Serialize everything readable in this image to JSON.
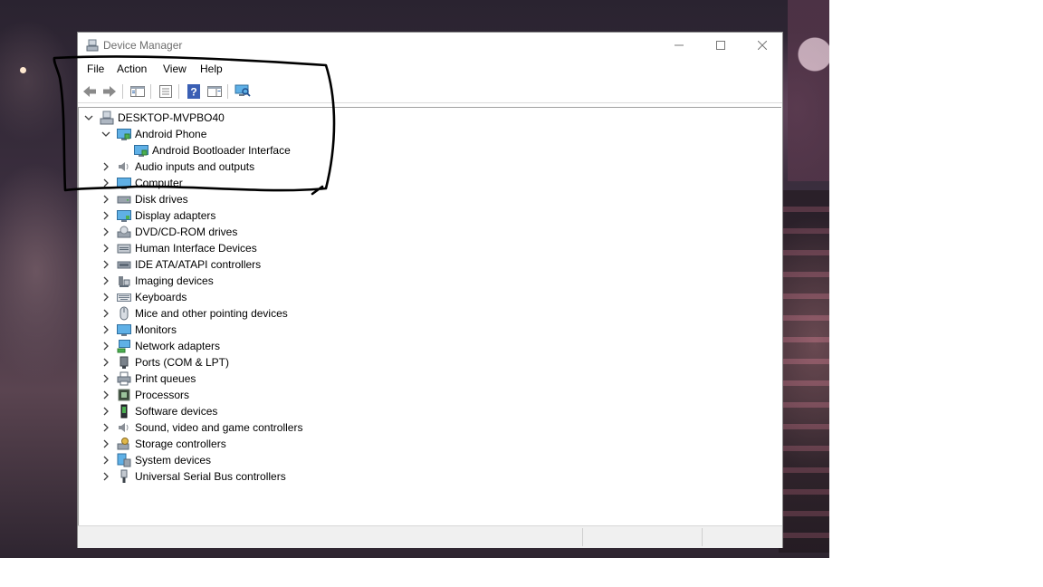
{
  "window": {
    "title": "Device Manager"
  },
  "menu": [
    "File",
    "Action",
    "View",
    "Help"
  ],
  "tree": {
    "root": "DESKTOP-MVPBO40",
    "android_group": "Android Phone",
    "android_child": "Android Bootloader Interface",
    "categories": [
      "Audio inputs and outputs",
      "Computer",
      "Disk drives",
      "Display adapters",
      "DVD/CD-ROM drives",
      "Human Interface Devices",
      "IDE ATA/ATAPI controllers",
      "Imaging devices",
      "Keyboards",
      "Mice and other pointing devices",
      "Monitors",
      "Network adapters",
      "Ports (COM & LPT)",
      "Print queues",
      "Processors",
      "Software devices",
      "Sound, video and game controllers",
      "Storage controllers",
      "System devices",
      "Universal Serial Bus controllers"
    ]
  },
  "icons": {
    "root": "computer-icon",
    "android": "android-device-icon",
    "categories": [
      "speaker-icon",
      "monitor-icon",
      "disk-icon",
      "display-icon",
      "dvd-icon",
      "hid-icon",
      "ide-icon",
      "camera-icon",
      "keyboard-icon",
      "mouse-icon",
      "monitor-icon",
      "network-icon",
      "port-icon",
      "printer-icon",
      "cpu-icon",
      "software-icon",
      "speaker-icon",
      "storage-icon",
      "system-icon",
      "usb-icon"
    ]
  },
  "colors": {
    "annotation": "#000000",
    "accent": "#1e6fd0"
  }
}
